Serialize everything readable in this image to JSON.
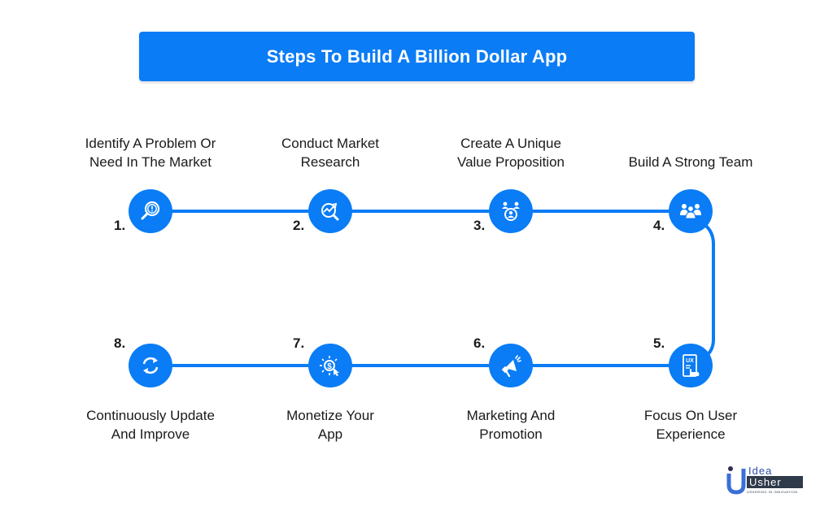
{
  "title": "Steps To Build A Billion Dollar App",
  "accent_color": "#0a7cf5",
  "steps": [
    {
      "number": "1.",
      "label_line1": "Identify A Problem Or",
      "label_line2": "Need In The Market",
      "icon": "search-alert-icon"
    },
    {
      "number": "2.",
      "label_line1": "Conduct Market",
      "label_line2": "Research",
      "icon": "market-research-icon"
    },
    {
      "number": "3.",
      "label_line1": "Create A Unique",
      "label_line2": "Value Proposition",
      "icon": "user-group-focus-icon"
    },
    {
      "number": "4.",
      "label_line1": "Build A Strong Team",
      "label_line2": "",
      "icon": "team-icon"
    },
    {
      "number": "5.",
      "label_line1": "Focus On User",
      "label_line2": "Experience",
      "icon": "ux-touch-icon"
    },
    {
      "number": "6.",
      "label_line1": "Marketing And",
      "label_line2": "Promotion",
      "icon": "megaphone-icon"
    },
    {
      "number": "7.",
      "label_line1": "Monetize Your",
      "label_line2": "App",
      "icon": "dollar-click-icon"
    },
    {
      "number": "8.",
      "label_line1": "Continuously Update",
      "label_line2": "And Improve",
      "icon": "refresh-icon"
    }
  ],
  "logo": {
    "line1": "Idea",
    "line2": "Usher",
    "tagline": "ushering in innovation"
  }
}
